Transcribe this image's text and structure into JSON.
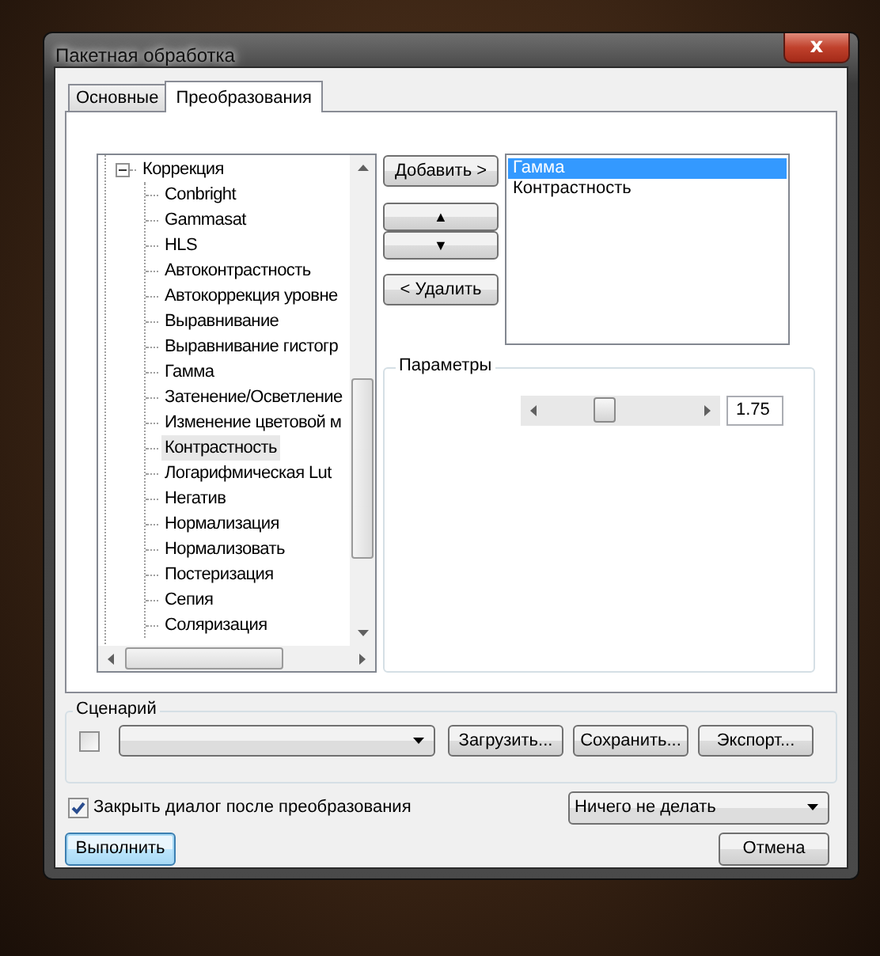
{
  "window": {
    "title": "Пакетная обработка",
    "close": "x"
  },
  "tabs": [
    {
      "label": "Основные",
      "selected": false
    },
    {
      "label": "Преобразования",
      "selected": true
    }
  ],
  "tree": [
    {
      "label": "Коррекция",
      "expanded": true,
      "selected": false,
      "children": [
        {
          "label": "Conbright",
          "selected": false
        },
        {
          "label": "Gammasat",
          "selected": false
        },
        {
          "label": "HLS",
          "selected": false
        },
        {
          "label": "Автоконтрастность",
          "selected": false
        },
        {
          "label": "Автокоррекция уровне",
          "selected": false
        },
        {
          "label": "Выравнивание",
          "selected": false
        },
        {
          "label": "Выравнивание гистогр",
          "selected": false
        },
        {
          "label": "Гамма",
          "selected": false
        },
        {
          "label": "Затенение/Осветление",
          "selected": false
        },
        {
          "label": "Изменение цветовой м",
          "selected": false
        },
        {
          "label": "Контрастность",
          "selected": true
        },
        {
          "label": "Логарифмическая Lut",
          "selected": false
        },
        {
          "label": "Негатив",
          "selected": false
        },
        {
          "label": "Нормализация",
          "selected": false
        },
        {
          "label": "Нормализовать",
          "selected": false
        },
        {
          "label": "Постеризация",
          "selected": false
        },
        {
          "label": "Сепия",
          "selected": false
        },
        {
          "label": "Соляризация",
          "selected": false
        }
      ]
    }
  ],
  "add_button": "Добавить >",
  "up_button": "▲",
  "down_button": "▼",
  "remove_button": "< Удалить",
  "chain": [
    {
      "label": "Гамма",
      "selected": true
    },
    {
      "label": "Контрастность",
      "selected": false
    }
  ],
  "parameters": {
    "title": "Параметры",
    "level": 0.4,
    "value": "1.75"
  },
  "scenario": {
    "title": "Сценарий",
    "checked": false,
    "buttons": [
      "Загрузить...",
      "Сохранить...",
      "Экспорт..."
    ]
  },
  "close_after": {
    "label": "Закрыть диалог после преобразования",
    "checked": true
  },
  "after_action": "Ничего не делать",
  "run_button": "Выполнить",
  "cancel_button": "Отмена"
}
